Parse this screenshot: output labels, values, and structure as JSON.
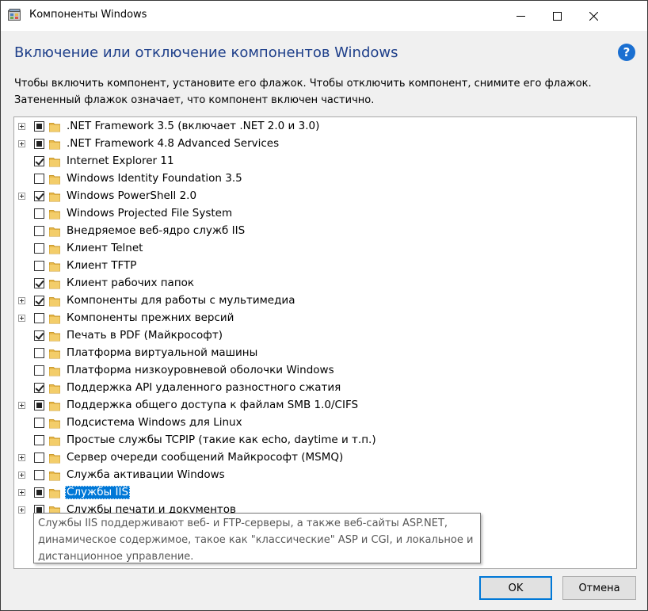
{
  "window": {
    "title": "Компоненты Windows",
    "heading": "Включение или отключение компонентов Windows",
    "help_glyph": "?",
    "description_line1": "Чтобы включить компонент, установите его флажок. Чтобы отключить компонент, снимите его флажок.",
    "description_line2": "Затененный флажок означает, что компонент включен частично."
  },
  "titlebar": {
    "minimize_glyph": "—",
    "maximize_glyph": "☐",
    "close_glyph": "✕"
  },
  "features": [
    {
      "label": ".NET Framework 3.5 (включает .NET 2.0 и 3.0)",
      "state": "partial",
      "expandable": true
    },
    {
      "label": ".NET Framework 4.8 Advanced Services",
      "state": "partial",
      "expandable": true
    },
    {
      "label": "Internet Explorer 11",
      "state": "checked",
      "expandable": false
    },
    {
      "label": "Windows Identity Foundation 3.5",
      "state": "unchecked",
      "expandable": false
    },
    {
      "label": "Windows PowerShell 2.0",
      "state": "checked",
      "expandable": true
    },
    {
      "label": "Windows Projected File System",
      "state": "unchecked",
      "expandable": false
    },
    {
      "label": "Внедряемое веб-ядро служб IIS",
      "state": "unchecked",
      "expandable": false
    },
    {
      "label": "Клиент Telnet",
      "state": "unchecked",
      "expandable": false
    },
    {
      "label": "Клиент TFTP",
      "state": "unchecked",
      "expandable": false
    },
    {
      "label": "Клиент рабочих папок",
      "state": "checked",
      "expandable": false
    },
    {
      "label": "Компоненты для работы с мультимедиа",
      "state": "checked",
      "expandable": true
    },
    {
      "label": "Компоненты прежних версий",
      "state": "unchecked",
      "expandable": true
    },
    {
      "label": "Печать в PDF (Майкрософт)",
      "state": "checked",
      "expandable": false
    },
    {
      "label": "Платформа виртуальной машины",
      "state": "unchecked",
      "expandable": false
    },
    {
      "label": "Платформа низкоуровневой оболочки Windows",
      "state": "unchecked",
      "expandable": false
    },
    {
      "label": "Поддержка API удаленного разностного сжатия",
      "state": "checked",
      "expandable": false
    },
    {
      "label": "Поддержка общего доступа к файлам SMB 1.0/CIFS",
      "state": "partial",
      "expandable": true
    },
    {
      "label": "Подсистема Windows для Linux",
      "state": "unchecked",
      "expandable": false
    },
    {
      "label": "Простые службы TCPIP (такие как echo, daytime и т.п.)",
      "state": "unchecked",
      "expandable": false
    },
    {
      "label": "Сервер очереди сообщений Майкрософт (MSMQ)",
      "state": "unchecked",
      "expandable": true
    },
    {
      "label": "Служба активации Windows",
      "state": "unchecked",
      "expandable": true
    },
    {
      "label": "Службы IIS",
      "state": "partial",
      "expandable": true,
      "selected": true
    },
    {
      "label": "Службы печати и документов",
      "state": "partial",
      "expandable": true
    }
  ],
  "tooltip": {
    "line1": "Службы IIS поддерживают веб- и FTP-серверы, а также веб-сайты ASP.NET,",
    "line2": "динамическое содержимое, такое как \"классические\" ASP и CGI, и локальное и",
    "line3": "дистанционное управление."
  },
  "buttons": {
    "ok": "OK",
    "cancel": "Отмена"
  },
  "colors": {
    "heading": "#1e3f8a",
    "selection": "#0078d7",
    "folder": "#e8b84a"
  }
}
